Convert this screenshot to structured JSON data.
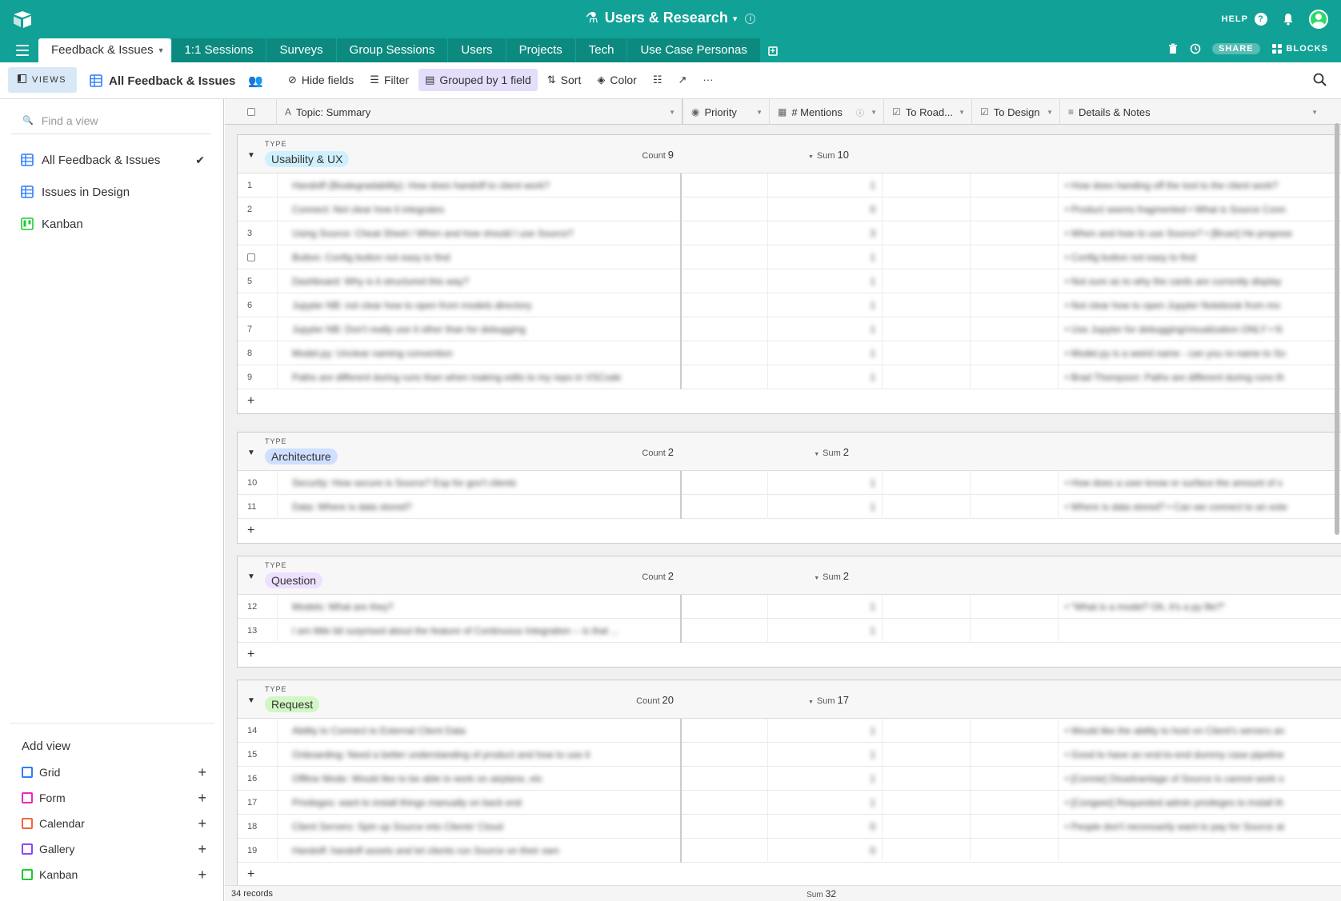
{
  "topbar": {
    "title": "Users & Research",
    "help_label": "HELP",
    "brand_color": "#11a196"
  },
  "tabs": [
    "Feedback & Issues",
    "1:1 Sessions",
    "Surveys",
    "Group Sessions",
    "Users",
    "Projects",
    "Tech",
    "Use Case Personas"
  ],
  "tabbar_right": {
    "share_label": "SHARE",
    "blocks_label": "BLOCKS"
  },
  "viewbar": {
    "views_label": "VIEWS",
    "current_view": "All Feedback & Issues",
    "tools": [
      "Hide fields",
      "Filter",
      "Grouped by 1 field",
      "Sort",
      "Color"
    ]
  },
  "sidebar": {
    "search_placeholder": "Find a view",
    "views": [
      {
        "label": "All Feedback & Issues",
        "icon": "grid-icon",
        "selected": true
      },
      {
        "label": "Issues in Design",
        "icon": "grid-icon",
        "selected": false
      },
      {
        "label": "Kanban",
        "icon": "kanban-icon",
        "selected": false
      }
    ],
    "add_view_title": "Add view",
    "add_view_items": [
      {
        "label": "Grid",
        "color": "#2d7ff9"
      },
      {
        "label": "Form",
        "color": "#e929ba"
      },
      {
        "label": "Calendar",
        "color": "#f7653b"
      },
      {
        "label": "Gallery",
        "color": "#8b46ff"
      },
      {
        "label": "Kanban",
        "color": "#20c933"
      }
    ]
  },
  "columns": {
    "topic": "Topic: Summary",
    "priority": "Priority",
    "mentions": "# Mentions",
    "roadmap": "To Road...",
    "design": "To Design",
    "notes": "Details & Notes"
  },
  "groups": [
    {
      "type_label": "TYPE",
      "name": "Usability & UX",
      "color": "#d0f0fd",
      "count_label": "Count",
      "count": "9",
      "sum_label": "Sum",
      "sum": "10",
      "rows": [
        {
          "num": "1",
          "topic": "Handoff (Biodegradability): How does handoff to client work?",
          "mentions": "1",
          "notes": "• How does handing off the tool to the client work?"
        },
        {
          "num": "2",
          "topic": "Connect: Not clear how it integrates",
          "mentions": "0",
          "notes": "• Product seems fragmented • What is Source Conn"
        },
        {
          "num": "3",
          "topic": "Using Source: Cheat Sheet / When and how should I use Source?",
          "mentions": "3",
          "notes": "• When and how to use Source? • [Bruer] He propose"
        },
        {
          "num": "",
          "topic": "Button: Config button not easy to find",
          "mentions": "1",
          "notes": "• Config button not easy to find"
        },
        {
          "num": "5",
          "topic": "Dashboard: Why is it structured this way?",
          "mentions": "1",
          "notes": "• Not sure as to why the cards are currently display"
        },
        {
          "num": "6",
          "topic": "Jupyter NB: not clear how to open from models directory",
          "mentions": "1",
          "notes": "• Not clear how to open Jupyter Notebook from mo"
        },
        {
          "num": "7",
          "topic": "Jupyter NB: Don't really use it other than for debugging",
          "mentions": "1",
          "notes": "• Use Jupyter for debugging/visualization ONLY • N"
        },
        {
          "num": "8",
          "topic": "Model.py: Unclear naming convention",
          "mentions": "1",
          "notes": "• Model.py is a weird name - can you re-name to So"
        },
        {
          "num": "9",
          "topic": "Paths are different during runs than when making edits to my repo in VSCode",
          "mentions": "1",
          "notes": "• Brad Thompson: Paths are different during runs th"
        }
      ]
    },
    {
      "type_label": "TYPE",
      "name": "Architecture",
      "color": "#cfdfff",
      "count_label": "Count",
      "count": "2",
      "sum_label": "Sum",
      "sum": "2",
      "rows": [
        {
          "num": "10",
          "topic": "Security: How secure is Source? Esp for gov't clients",
          "mentions": "1",
          "notes": "• How does a user know or surface the amount of s"
        },
        {
          "num": "11",
          "topic": "Data: Where is data stored?",
          "mentions": "1",
          "notes": "• Where is data stored? • Can we connect to an exte"
        }
      ]
    },
    {
      "type_label": "TYPE",
      "name": "Question",
      "color": "#ede2fe",
      "count_label": "Count",
      "count": "2",
      "sum_label": "Sum",
      "sum": "2",
      "rows": [
        {
          "num": "12",
          "topic": "Models: What are they?",
          "mentions": "1",
          "notes": "• \"What is a model? Oh, it's a py file?\""
        },
        {
          "num": "13",
          "topic": "I am little bit surprised about the feature of Continuous Integration -- is that ...",
          "mentions": "1",
          "notes": ""
        }
      ]
    },
    {
      "type_label": "TYPE",
      "name": "Request",
      "color": "#d1f7c4",
      "count_label": "Count",
      "count": "20",
      "sum_label": "Sum",
      "sum": "17",
      "rows": [
        {
          "num": "14",
          "topic": "Ability to Connect to External Client Data",
          "mentions": "1",
          "notes": "• Would like the ability to host on Client's servers an"
        },
        {
          "num": "15",
          "topic": "Onboarding: Need a better understanding of product and how to use it",
          "mentions": "1",
          "notes": "• Good to have an end-to-end dummy case pipeline"
        },
        {
          "num": "16",
          "topic": "Offline Mode: Would like to be able to work on airplane, etc",
          "mentions": "1",
          "notes": "• [Connie] Disadvantage of Source is cannot work o"
        },
        {
          "num": "17",
          "topic": "Privileges: want to install things manually on back end",
          "mentions": "1",
          "notes": "• [Congwei] Requested admin privileges to install th"
        },
        {
          "num": "18",
          "topic": "Client Servers: Spin up Source into Clients' Cloud",
          "mentions": "0",
          "notes": "• People don't necessarily want to pay for Source at"
        },
        {
          "num": "19",
          "topic": "Handoff: handoff assets and let clients run Source on their own",
          "mentions": "0",
          "notes": ""
        }
      ]
    }
  ],
  "footer": {
    "records": "34 records",
    "sum_label": "Sum",
    "sum": "32"
  }
}
